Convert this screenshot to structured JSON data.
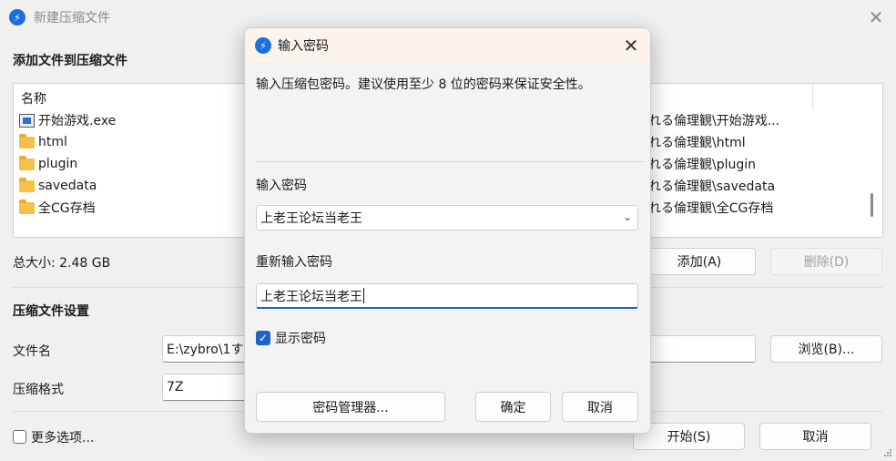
{
  "main": {
    "title": "新建压缩文件",
    "add_section_title": "添加文件到压缩文件",
    "file_list": {
      "header": "名称",
      "items": [
        {
          "name": "开始游戏.exe",
          "type": "exe",
          "path": "れる倫理観\\开始游戏..."
        },
        {
          "name": "html",
          "type": "folder",
          "path": "れる倫理観\\html"
        },
        {
          "name": "plugin",
          "type": "folder",
          "path": "れる倫理観\\plugin"
        },
        {
          "name": "savedata",
          "type": "folder",
          "path": "れる倫理観\\savedata"
        },
        {
          "name": "全CG存档",
          "type": "folder",
          "path": "れる倫理観\\全CG存档"
        }
      ]
    },
    "total_size": "总大小: 2.48 GB",
    "add_button": "添加(A)",
    "delete_button": "删除(D)",
    "settings_title": "压缩文件设置",
    "filename_label": "文件名",
    "filename_value": "E:\\zybro\\1す",
    "browse_button": "浏览(B)...",
    "format_label": "压缩格式",
    "format_value": "7Z",
    "more_options": "更多选项...",
    "start_button": "开始(S)",
    "cancel_button": "取消"
  },
  "dialog": {
    "title": "输入密码",
    "description": "输入压缩包密码。建议使用至少 8 位的密码来保证安全性。",
    "password_label": "输入密码",
    "password_value": "上老王论坛当老王",
    "reenter_label": "重新输入密码",
    "reenter_value": "上老王论坛当老王",
    "show_password_label": "显示密码",
    "show_password_checked": true,
    "manager_button": "密码管理器...",
    "ok_button": "确定",
    "cancel_button": "取消"
  },
  "colors": {
    "accent": "#1e64c8",
    "folder": "#f4c04a",
    "dialog_titlebar": "#fbf3ec"
  }
}
